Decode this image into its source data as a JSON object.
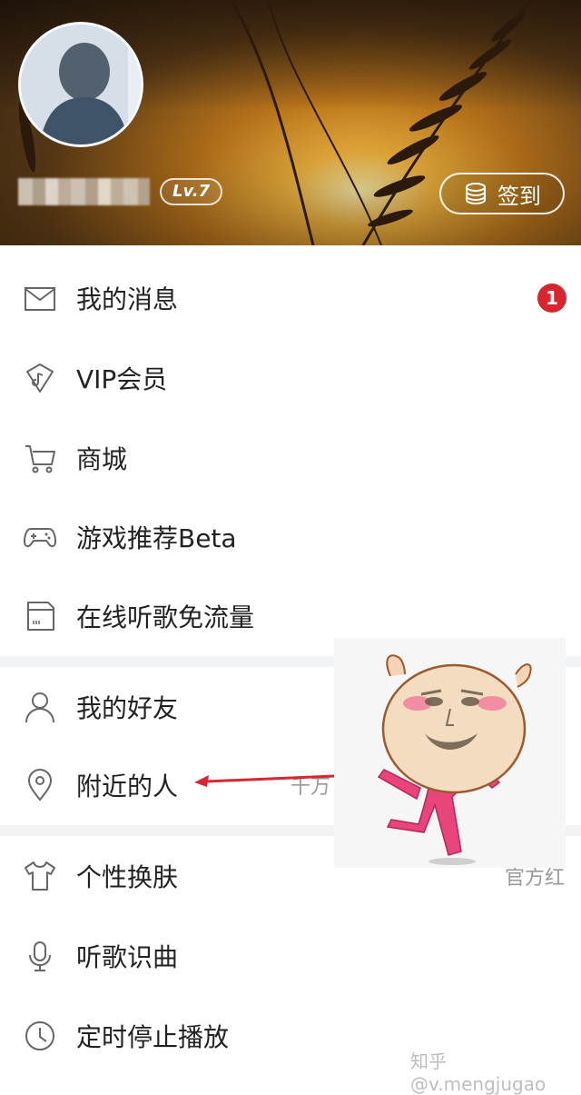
{
  "header": {
    "level": "Lv.7",
    "checkin_label": "签到"
  },
  "menu": {
    "group1": [
      {
        "label": "我的消息",
        "icon": "envelope-icon",
        "badge": "1"
      },
      {
        "label": "VIP会员",
        "icon": "vip-diamond-icon"
      },
      {
        "label": "商城",
        "icon": "cart-icon"
      },
      {
        "label": "游戏推荐Beta",
        "icon": "gamepad-icon"
      },
      {
        "label": "在线听歌免流量",
        "icon": "sim-card-icon"
      }
    ],
    "group2": [
      {
        "label": "我的好友",
        "icon": "person-icon"
      },
      {
        "label": "附近的人",
        "icon": "location-pin-icon",
        "right": "千万"
      }
    ],
    "group3": [
      {
        "label": "个性换肤",
        "icon": "tshirt-icon",
        "right": "官方红"
      },
      {
        "label": "听歌识曲",
        "icon": "microphone-icon"
      },
      {
        "label": "定时停止播放",
        "icon": "clock-icon"
      }
    ]
  },
  "watermark": "知乎 @v.mengjugao",
  "colors": {
    "badge": "#d9252f",
    "divider": "#f2f3f5",
    "arrow": "#d9252f"
  }
}
